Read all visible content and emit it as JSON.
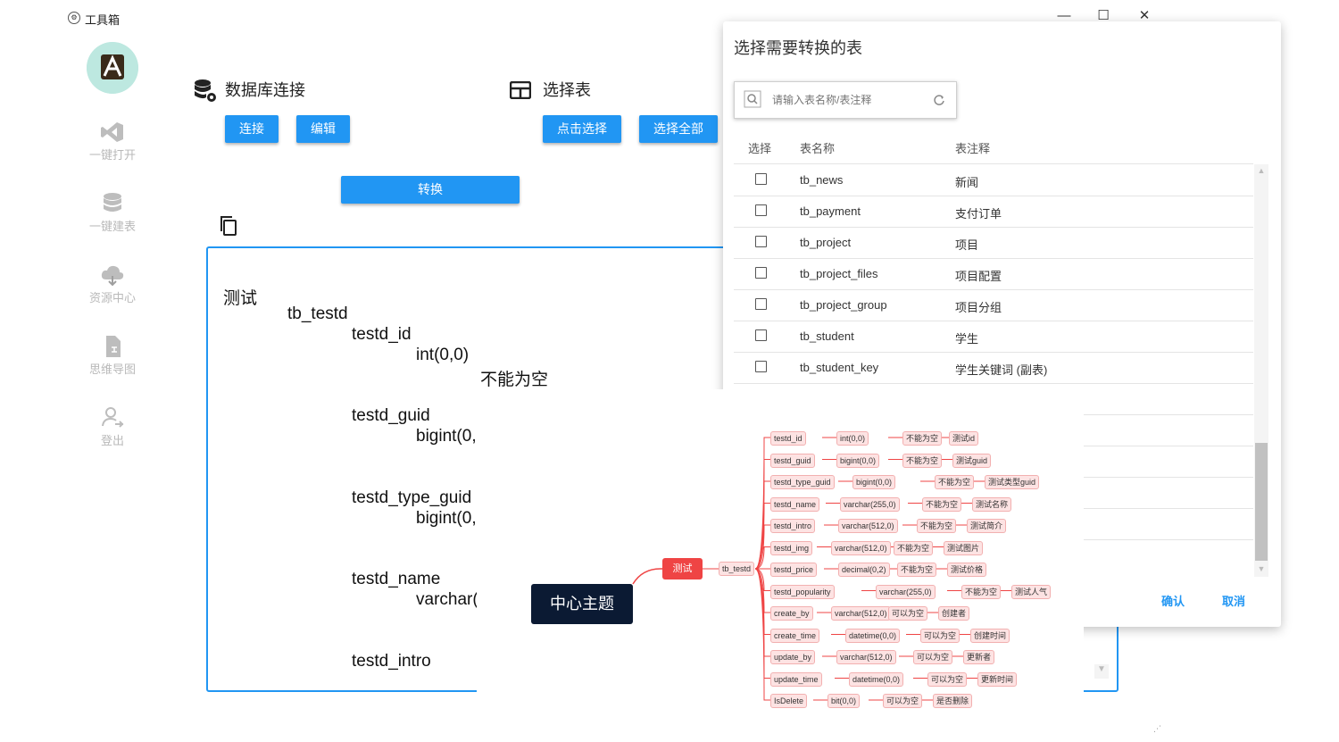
{
  "window": {
    "title": "工具箱",
    "minimize": "—",
    "maximize": "☐",
    "close": "✕"
  },
  "sidebar": {
    "items": [
      {
        "label": "一键打开",
        "icon": "vscode-icon"
      },
      {
        "label": "一键建表",
        "icon": "database-icon"
      },
      {
        "label": "资源中心",
        "icon": "cloud-download-icon"
      },
      {
        "label": "思维导图",
        "icon": "mindmap-file-icon"
      },
      {
        "label": "登出",
        "icon": "logout-user-icon"
      }
    ]
  },
  "db_section": {
    "title": "数据库连接",
    "connect": "连接",
    "edit": "编辑"
  },
  "table_section": {
    "title": "选择表",
    "click_select": "点击选择",
    "select_all": "选择全部"
  },
  "convert_button": "转换",
  "textbox": {
    "lines": [
      {
        "text": "测试",
        "indent": 0
      },
      {
        "text": "tb_testd",
        "indent": 1
      },
      {
        "text": "testd_id",
        "indent": 2
      },
      {
        "text": "int(0,0)",
        "indent": 3
      },
      {
        "text": "不能为空",
        "indent": 4
      },
      {
        "text": "testd_guid",
        "indent": 2
      },
      {
        "text": "bigint(0,",
        "indent": 3
      },
      {
        "text": "testd_type_guid",
        "indent": 2
      },
      {
        "text": "bigint(0,",
        "indent": 3
      },
      {
        "text": "testd_name",
        "indent": 2
      },
      {
        "text": "varchar(",
        "indent": 3
      },
      {
        "text": "testd_intro",
        "indent": 2
      }
    ]
  },
  "dialog": {
    "title": "选择需要转换的表",
    "search_placeholder": "请输入表名称/表注释",
    "columns": {
      "select": "选择",
      "name": "表名称",
      "comment": "表注释"
    },
    "rows": [
      {
        "name": "tb_news",
        "comment": "新闻"
      },
      {
        "name": "tb_payment",
        "comment": "支付订单"
      },
      {
        "name": "tb_project",
        "comment": "项目"
      },
      {
        "name": "tb_project_files",
        "comment": "项目配置"
      },
      {
        "name": "tb_project_group",
        "comment": "项目分组"
      },
      {
        "name": "tb_student",
        "comment": "学生"
      },
      {
        "name": "tb_student_key",
        "comment": "学生关键词 (副表)"
      }
    ],
    "confirm": "确认",
    "cancel": "取消"
  },
  "mindmap": {
    "center": "中心主题",
    "level1": "测试",
    "level2": "tb_testd",
    "fields": [
      [
        "testd_id",
        "int(0,0)",
        "不能为空",
        "测试id"
      ],
      [
        "testd_guid",
        "bigint(0,0)",
        "不能为空",
        "测试guid"
      ],
      [
        "testd_type_guid",
        "bigint(0,0)",
        "不能为空",
        "测试类型guid"
      ],
      [
        "testd_name",
        "varchar(255,0)",
        "不能为空",
        "测试名称"
      ],
      [
        "testd_intro",
        "varchar(512,0)",
        "不能为空",
        "测试简介"
      ],
      [
        "testd_img",
        "varchar(512,0)",
        "不能为空",
        "测试图片"
      ],
      [
        "testd_price",
        "decimal(0,2)",
        "不能为空",
        "测试价格"
      ],
      [
        "testd_popularity",
        "varchar(255,0)",
        "不能为空",
        "测试人气"
      ],
      [
        "create_by",
        "varchar(512,0)",
        "可以为空",
        "创建者"
      ],
      [
        "create_time",
        "datetime(0,0)",
        "可以为空",
        "创建时间"
      ],
      [
        "update_by",
        "varchar(512,0)",
        "可以为空",
        "更新者"
      ],
      [
        "update_time",
        "datetime(0,0)",
        "可以为空",
        "更新时间"
      ],
      [
        "IsDelete",
        "bit(0,0)",
        "可以为空",
        "是否删除"
      ]
    ]
  },
  "colors": {
    "accent": "#2196f3",
    "mind_center": "#0b1a33",
    "mind_level1": "#ef4444",
    "mind_node": "#fde3e3"
  }
}
